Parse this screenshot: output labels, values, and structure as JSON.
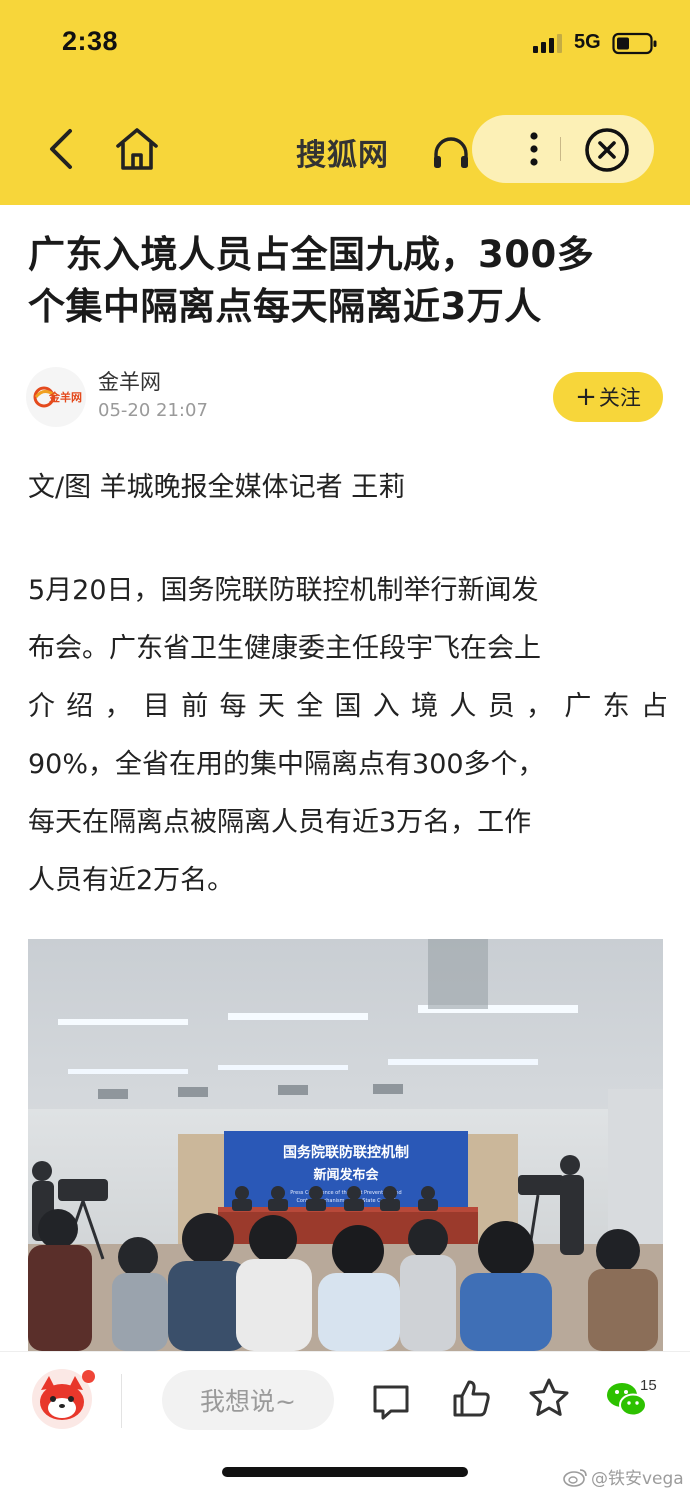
{
  "status_bar": {
    "time": "2:38",
    "network": "5G",
    "icons": [
      "signal-icon",
      "battery-icon"
    ]
  },
  "nav": {
    "title": "搜狐网",
    "icons": [
      "back-icon",
      "home-icon",
      "headphones-icon",
      "more-icon",
      "close-icon"
    ]
  },
  "article": {
    "headline_line1": "广东入境人员占全国九成，300多",
    "headline_line2": "个集中隔离点每天隔离近3万人",
    "source": {
      "name": "金羊网",
      "time": "05-20 21:07",
      "logo_text": "金羊网"
    },
    "follow_label": "关注",
    "byline": "文/图 羊城晚报全媒体记者 王莉",
    "paragraph_lines": [
      "5月20日，国务院联防联控机制举行新闻发",
      "布会。广东省卫生健康委主任段宇飞在会上",
      "介绍，目前每天全国入境人员，广东占",
      "90%，全省在用的集中隔离点有300多个，",
      "每天在隔离点被隔离人员有近3万名，工作",
      "人员有近2万名。"
    ],
    "photo": {
      "banner_line1": "国务院联防联控机制",
      "banner_line2": "新闻发布会",
      "banner_en_line1": "Press Conference of the Joint Prevention and",
      "banner_en_line2": "Control Mechanism of the State Council"
    }
  },
  "bottom_bar": {
    "comment_placeholder": "我想说~",
    "share_count": "15",
    "icons": [
      "mascot-avatar",
      "comment-icon",
      "like-icon",
      "star-icon",
      "wechat-icon"
    ]
  },
  "watermark": "@铁安vega",
  "colors": {
    "brand_yellow": "#f7d63a",
    "capsule": "#fcf0b6",
    "notification_red": "#ef4538",
    "banner_blue": "#2a58b7"
  }
}
